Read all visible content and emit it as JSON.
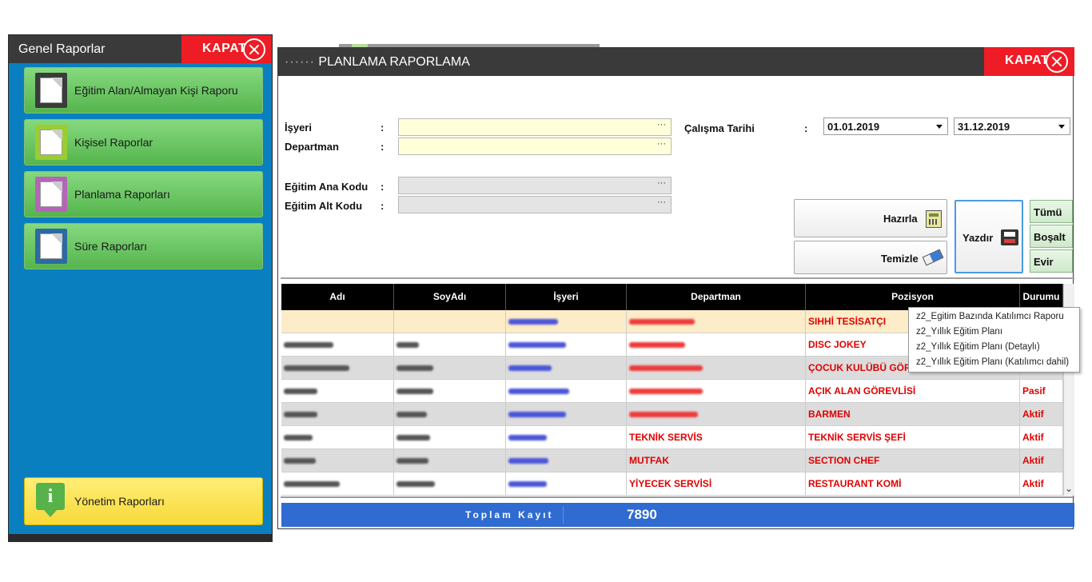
{
  "left_panel": {
    "title": "Genel Raporlar",
    "close_label": "KAPAT",
    "menu_items": [
      {
        "label": "Eğitim Alan/Almayan Kişi Raporu",
        "icon": "document-dark-icon"
      },
      {
        "label": "Kişisel Raporlar",
        "icon": "chart-document-icon"
      },
      {
        "label": "Planlama Raporları",
        "icon": "document-purple-icon"
      },
      {
        "label": "Süre Raporları",
        "icon": "document-blue-icon"
      }
    ],
    "management": {
      "label": "Yönetim Raporları",
      "icon": "info-icon",
      "glyph": "i"
    }
  },
  "main_panel": {
    "title_dots": "······",
    "title": "PLANLAMA RAPORLAMA",
    "close_label": "KAPAT",
    "form": {
      "isyeri_label": "İşyeri",
      "departman_label": "Departman",
      "egitim_ana_label": "Eğitim Ana Kodu",
      "egitim_alt_label": "Eğitim Alt Kodu",
      "calisma_tarihi_label": "Çalışma Tarihi",
      "colon": ":",
      "ellipsis": "···",
      "start_date": "01.01.2019",
      "end_date": "31.12.2019"
    },
    "buttons": {
      "hazirla": "Hazırla",
      "temizle": "Temizle",
      "yazdir": "Yazdır",
      "tumu": "Tümü",
      "bosalt": "Boşalt",
      "evir": "Evir"
    },
    "table": {
      "columns": [
        "Adı",
        "SoyAdı",
        "İşyeri",
        "Departman",
        "Pozisyon",
        "Durumu"
      ],
      "rows": [
        {
          "departman": "",
          "pozisyon": "SIHHİ TESİSATÇI",
          "durumu": ""
        },
        {
          "departman": "",
          "pozisyon": "DISC JOKEY",
          "durumu": ""
        },
        {
          "departman": "",
          "pozisyon": "ÇOCUK KULÜBÜ GÖREVLİSİ",
          "durumu": ""
        },
        {
          "departman": "",
          "pozisyon": "AÇIK ALAN GÖREVLİSİ",
          "durumu": "Pasif"
        },
        {
          "departman": "",
          "pozisyon": "BARMEN",
          "durumu": "Aktif"
        },
        {
          "departman": "TEKNİK SERVİS",
          "pozisyon": "TEKNİK SERVİS ŞEFİ",
          "durumu": "Aktif"
        },
        {
          "departman": "MUTFAK",
          "pozisyon": "SECTION CHEF",
          "durumu": "Aktif"
        },
        {
          "departman": "YİYECEK SERVİSİ",
          "pozisyon": "RESTAURANT KOMİ",
          "durumu": "Aktif"
        }
      ]
    },
    "footer": {
      "label": "Toplam Kayıt",
      "value": "7890"
    },
    "report_menu": [
      "z2_Egitim Bazında Katılımcı Raporu",
      "z2_Yıllık Eğitim Planı",
      "z2_Yıllık Eğitim Planı (Detaylı)",
      "z2_Yıllık Eğitim Planı (Katılımcı dahil)"
    ]
  },
  "colors": {
    "accent_blue": "#0a7fc0",
    "close_red": "#ee1c25",
    "footer_blue": "#2f6bd0",
    "text_red": "#e00000"
  }
}
